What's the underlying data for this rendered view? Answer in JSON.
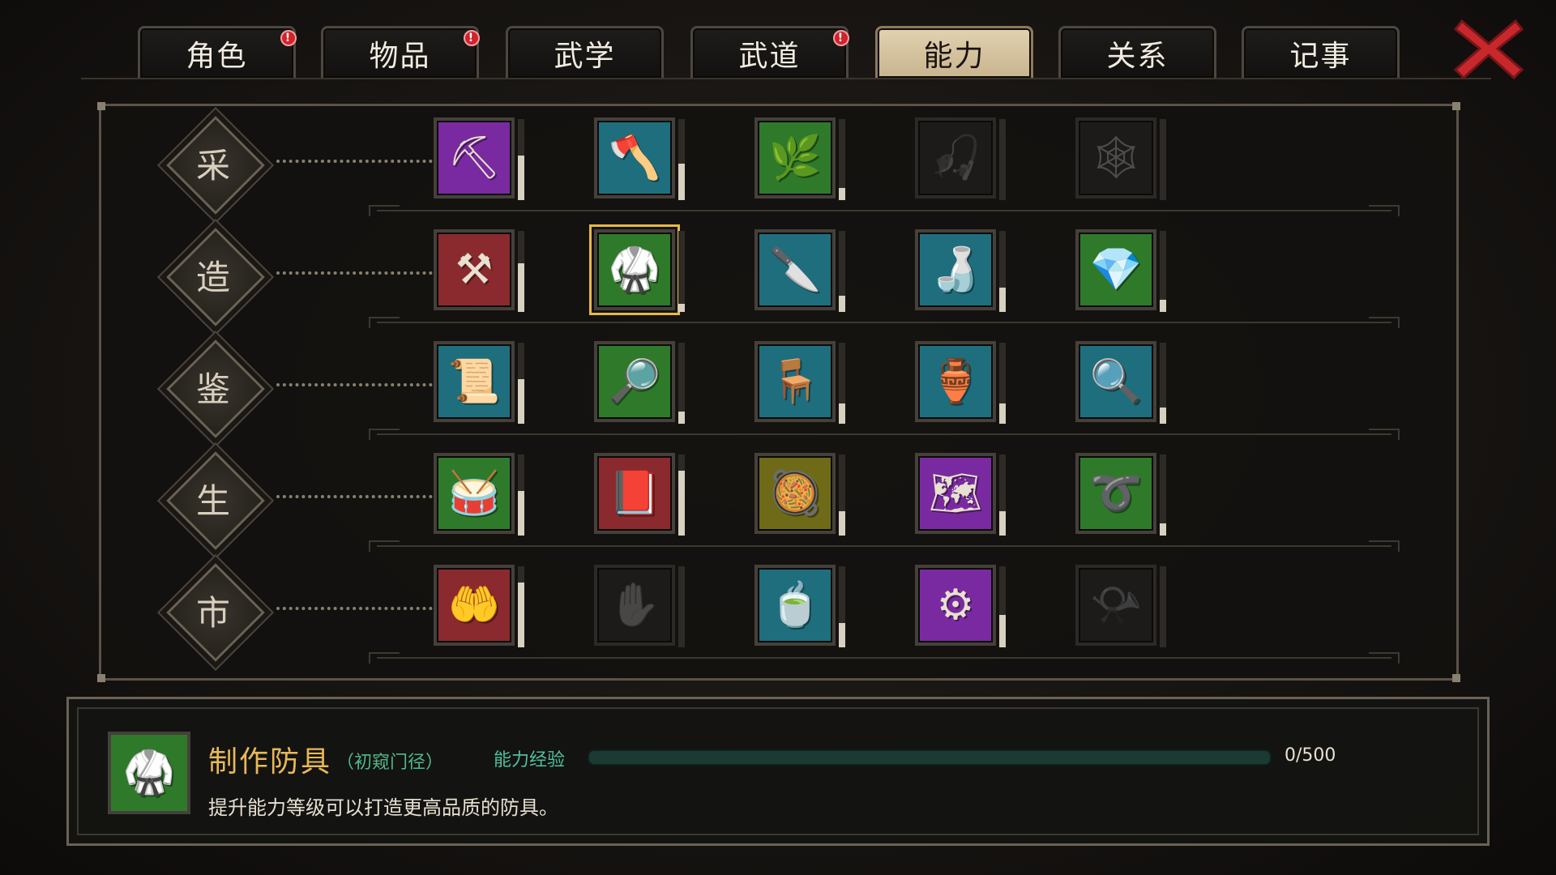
{
  "tabs": [
    {
      "label": "角色",
      "badge": "!",
      "active": false
    },
    {
      "label": "物品",
      "badge": "!",
      "active": false
    },
    {
      "label": "武学",
      "badge": "",
      "active": false
    },
    {
      "label": "武道",
      "badge": "!",
      "active": false
    },
    {
      "label": "能力",
      "badge": "",
      "active": true
    },
    {
      "label": "关系",
      "badge": "",
      "active": false
    },
    {
      "label": "记事",
      "badge": "",
      "active": false
    }
  ],
  "close_label": "✕",
  "rows": [
    {
      "label": "采",
      "cells": [
        {
          "name": "mining",
          "icon": "⛏",
          "color": "purple",
          "locked": false,
          "level": 0.55
        },
        {
          "name": "logging",
          "icon": "🪓",
          "color": "teal",
          "locked": false,
          "level": 0.45
        },
        {
          "name": "herb-gathering",
          "icon": "🌿",
          "color": "green",
          "locked": false,
          "level": 0.15
        },
        {
          "name": "fishing",
          "icon": "🎣",
          "color": "locked",
          "locked": true,
          "level": 0
        },
        {
          "name": "hunting",
          "icon": "🕸",
          "color": "locked",
          "locked": true,
          "level": 0
        }
      ]
    },
    {
      "label": "造",
      "cells": [
        {
          "name": "forging",
          "icon": "⚒",
          "color": "red",
          "locked": false,
          "level": 0.6
        },
        {
          "name": "armor-crafting",
          "icon": "🥋",
          "color": "green",
          "locked": false,
          "level": 0.1,
          "selected": true
        },
        {
          "name": "herbalism",
          "icon": "🔪",
          "color": "teal",
          "locked": false,
          "level": 0.2
        },
        {
          "name": "cooking",
          "icon": "🍶",
          "color": "teal",
          "locked": false,
          "level": 0.3
        },
        {
          "name": "jewel-crafting",
          "icon": "💎",
          "color": "green",
          "locked": false,
          "level": 0.15
        }
      ]
    },
    {
      "label": "鉴",
      "cells": [
        {
          "name": "appraise-scroll",
          "icon": "📜",
          "color": "teal",
          "locked": false,
          "level": 0.55
        },
        {
          "name": "appraise-book",
          "icon": "🔎",
          "color": "green",
          "locked": false,
          "level": 0.15
        },
        {
          "name": "appraise-furniture",
          "icon": "🪑",
          "color": "teal",
          "locked": false,
          "level": 0.25
        },
        {
          "name": "appraise-antique",
          "icon": "🏺",
          "color": "teal",
          "locked": false,
          "level": 0.25
        },
        {
          "name": "appraise-gem",
          "icon": "🔍",
          "color": "teal",
          "locked": false,
          "level": 0.2
        }
      ]
    },
    {
      "label": "生",
      "cells": [
        {
          "name": "drum",
          "icon": "🥁",
          "color": "green",
          "locked": false,
          "level": 0.55
        },
        {
          "name": "tablet",
          "icon": "📕",
          "color": "red",
          "locked": false,
          "level": 0.8
        },
        {
          "name": "alchemy",
          "icon": "🥘",
          "color": "olive",
          "locked": false,
          "level": 0.3
        },
        {
          "name": "map-reading",
          "icon": "🗺",
          "color": "purple",
          "locked": false,
          "level": 0.3
        },
        {
          "name": "whip",
          "icon": "➰",
          "color": "green",
          "locked": false,
          "level": 0.15
        }
      ]
    },
    {
      "label": "市",
      "cells": [
        {
          "name": "bargaining",
          "icon": "🤲",
          "color": "red",
          "locked": false,
          "level": 0.8
        },
        {
          "name": "pickpocket",
          "icon": "✋",
          "color": "locked",
          "locked": true,
          "level": 0
        },
        {
          "name": "tea-brewing",
          "icon": "🍵",
          "color": "teal",
          "locked": false,
          "level": 0.3
        },
        {
          "name": "mechanics",
          "icon": "⚙",
          "color": "purple",
          "locked": false,
          "level": 0.4
        },
        {
          "name": "horn",
          "icon": "📯",
          "color": "locked",
          "locked": true,
          "level": 0
        }
      ]
    }
  ],
  "detail": {
    "icon": "🥋",
    "title": "制作防具",
    "rank": "（初窥门径）",
    "exp_label": "能力经验",
    "exp_value": "0/500",
    "exp_progress": 0,
    "description": "提升能力等级可以打造更高品质的防具。"
  }
}
